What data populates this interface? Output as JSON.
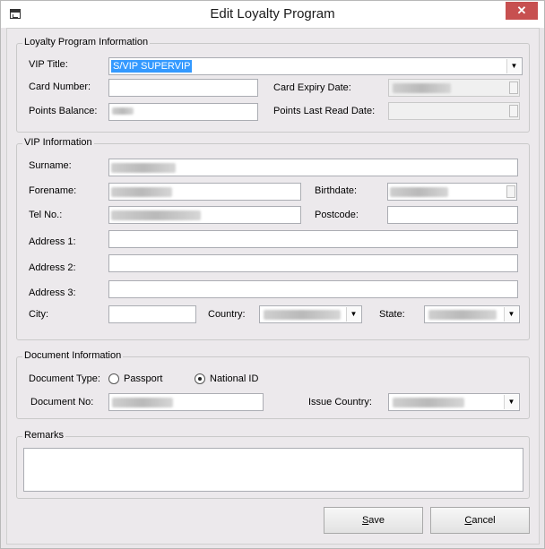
{
  "window": {
    "title": "Edit Loyalty Program",
    "close_glyph": "✕"
  },
  "loyalty": {
    "legend": "Loyalty Program Information",
    "vip_title_label": "VIP Title:",
    "vip_title_value": "S/VIP SUPERVIP",
    "card_number_label": "Card Number:",
    "card_expiry_label": "Card Expiry Date:",
    "points_balance_label": "Points Balance:",
    "points_last_read_label": "Points Last Read Date:"
  },
  "vip": {
    "legend": "VIP Information",
    "surname_label": "Surname:",
    "forename_label": "Forename:",
    "birthdate_label": "Birthdate:",
    "tel_label": "Tel No.:",
    "postcode_label": "Postcode:",
    "address1_label": "Address 1:",
    "address2_label": "Address 2:",
    "address3_label": "Address 3:",
    "city_label": "City:",
    "country_label": "Country:",
    "state_label": "State:"
  },
  "document": {
    "legend": "Document Information",
    "type_label": "Document Type:",
    "passport_label": "Passport",
    "national_id_label": "National ID",
    "selected_type": "National ID",
    "doc_no_label": "Document No:",
    "issue_country_label": "Issue Country:"
  },
  "remarks": {
    "legend": "Remarks"
  },
  "buttons": {
    "save_prefix": "",
    "save_key": "S",
    "save_rest": "ave",
    "cancel_key": "C",
    "cancel_rest": "ancel"
  },
  "icons": {
    "dropdown": "chevron-down-icon",
    "app": "app-icon",
    "close": "close-icon"
  },
  "colors": {
    "close_bg": "#c75050",
    "selection": "#3399ff"
  }
}
